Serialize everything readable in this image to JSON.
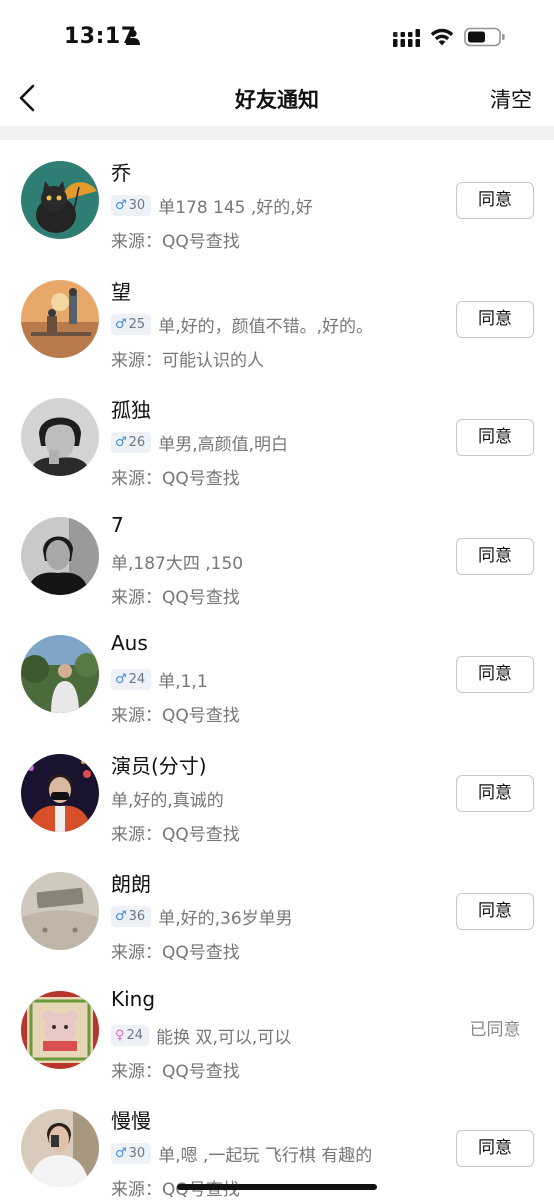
{
  "status_bar": {
    "time": "13:17"
  },
  "nav": {
    "title": "好友通知",
    "clear_label": "清空"
  },
  "requests": [
    {
      "name": "乔",
      "gender": "male",
      "age": "30",
      "desc": "单178 145 ,好的,好",
      "source": "来源：QQ号查找",
      "action": "同意",
      "agreed": false
    },
    {
      "name": "望",
      "gender": "male",
      "age": "25",
      "desc": "单,好的，颜值不错。,好的。",
      "source": "来源：可能认识的人",
      "action": "同意",
      "agreed": false
    },
    {
      "name": "孤独",
      "gender": "male",
      "age": "26",
      "desc": "单男,高颜值,明白",
      "source": "来源：QQ号查找",
      "action": "同意",
      "agreed": false
    },
    {
      "name": "7",
      "gender": null,
      "age": null,
      "desc": " 单,187大四 ,150",
      "source": "来源：QQ号查找",
      "action": "同意",
      "agreed": false
    },
    {
      "name": "Aus",
      "gender": "male",
      "age": "24",
      "desc": "单,1,1",
      "source": "来源：QQ号查找",
      "action": "同意",
      "agreed": false
    },
    {
      "name": "演员(分寸)",
      "gender": null,
      "age": null,
      "desc": "单,好的,真诚的",
      "source": "来源：QQ号查找",
      "action": "同意",
      "agreed": false
    },
    {
      "name": "朗朗",
      "gender": "male",
      "age": "36",
      "desc": "单,好的,36岁单男",
      "source": "来源：QQ号查找",
      "action": "同意",
      "agreed": false
    },
    {
      "name": "King",
      "gender": "female",
      "age": "24",
      "desc": "能换 双,可以,可以",
      "source": "来源：QQ号查找",
      "action": "已同意",
      "agreed": true
    },
    {
      "name": "慢慢",
      "gender": "male",
      "age": "30",
      "desc": "单,嗯 ,一起玩 飞行棋 有趣的",
      "source": "来源：QQ号查找",
      "action": "同意",
      "agreed": false
    }
  ],
  "icons": {
    "male": "♂",
    "female": "♀"
  }
}
